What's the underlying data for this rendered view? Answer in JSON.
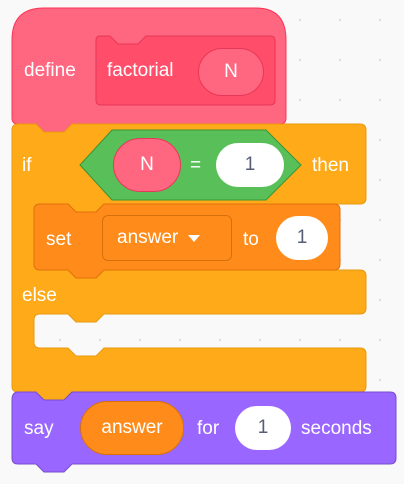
{
  "define_block": {
    "keyword": "define",
    "proc_name": "factorial",
    "param": "N",
    "color": "#ff6680"
  },
  "if_block": {
    "if_label": "if",
    "then_label": "then",
    "else_label": "else",
    "color": "#ffab19",
    "condition": {
      "left": "N",
      "operator": "=",
      "right": "1",
      "color": "#59c059"
    }
  },
  "set_block": {
    "label": "set",
    "variable": "answer",
    "to_label": "to",
    "value": "1",
    "color": "#ff8c1a"
  },
  "say_block": {
    "label": "say",
    "reporter": "answer",
    "for_label": "for",
    "duration": "1",
    "unit_label": "seconds",
    "color": "#9966ff"
  }
}
